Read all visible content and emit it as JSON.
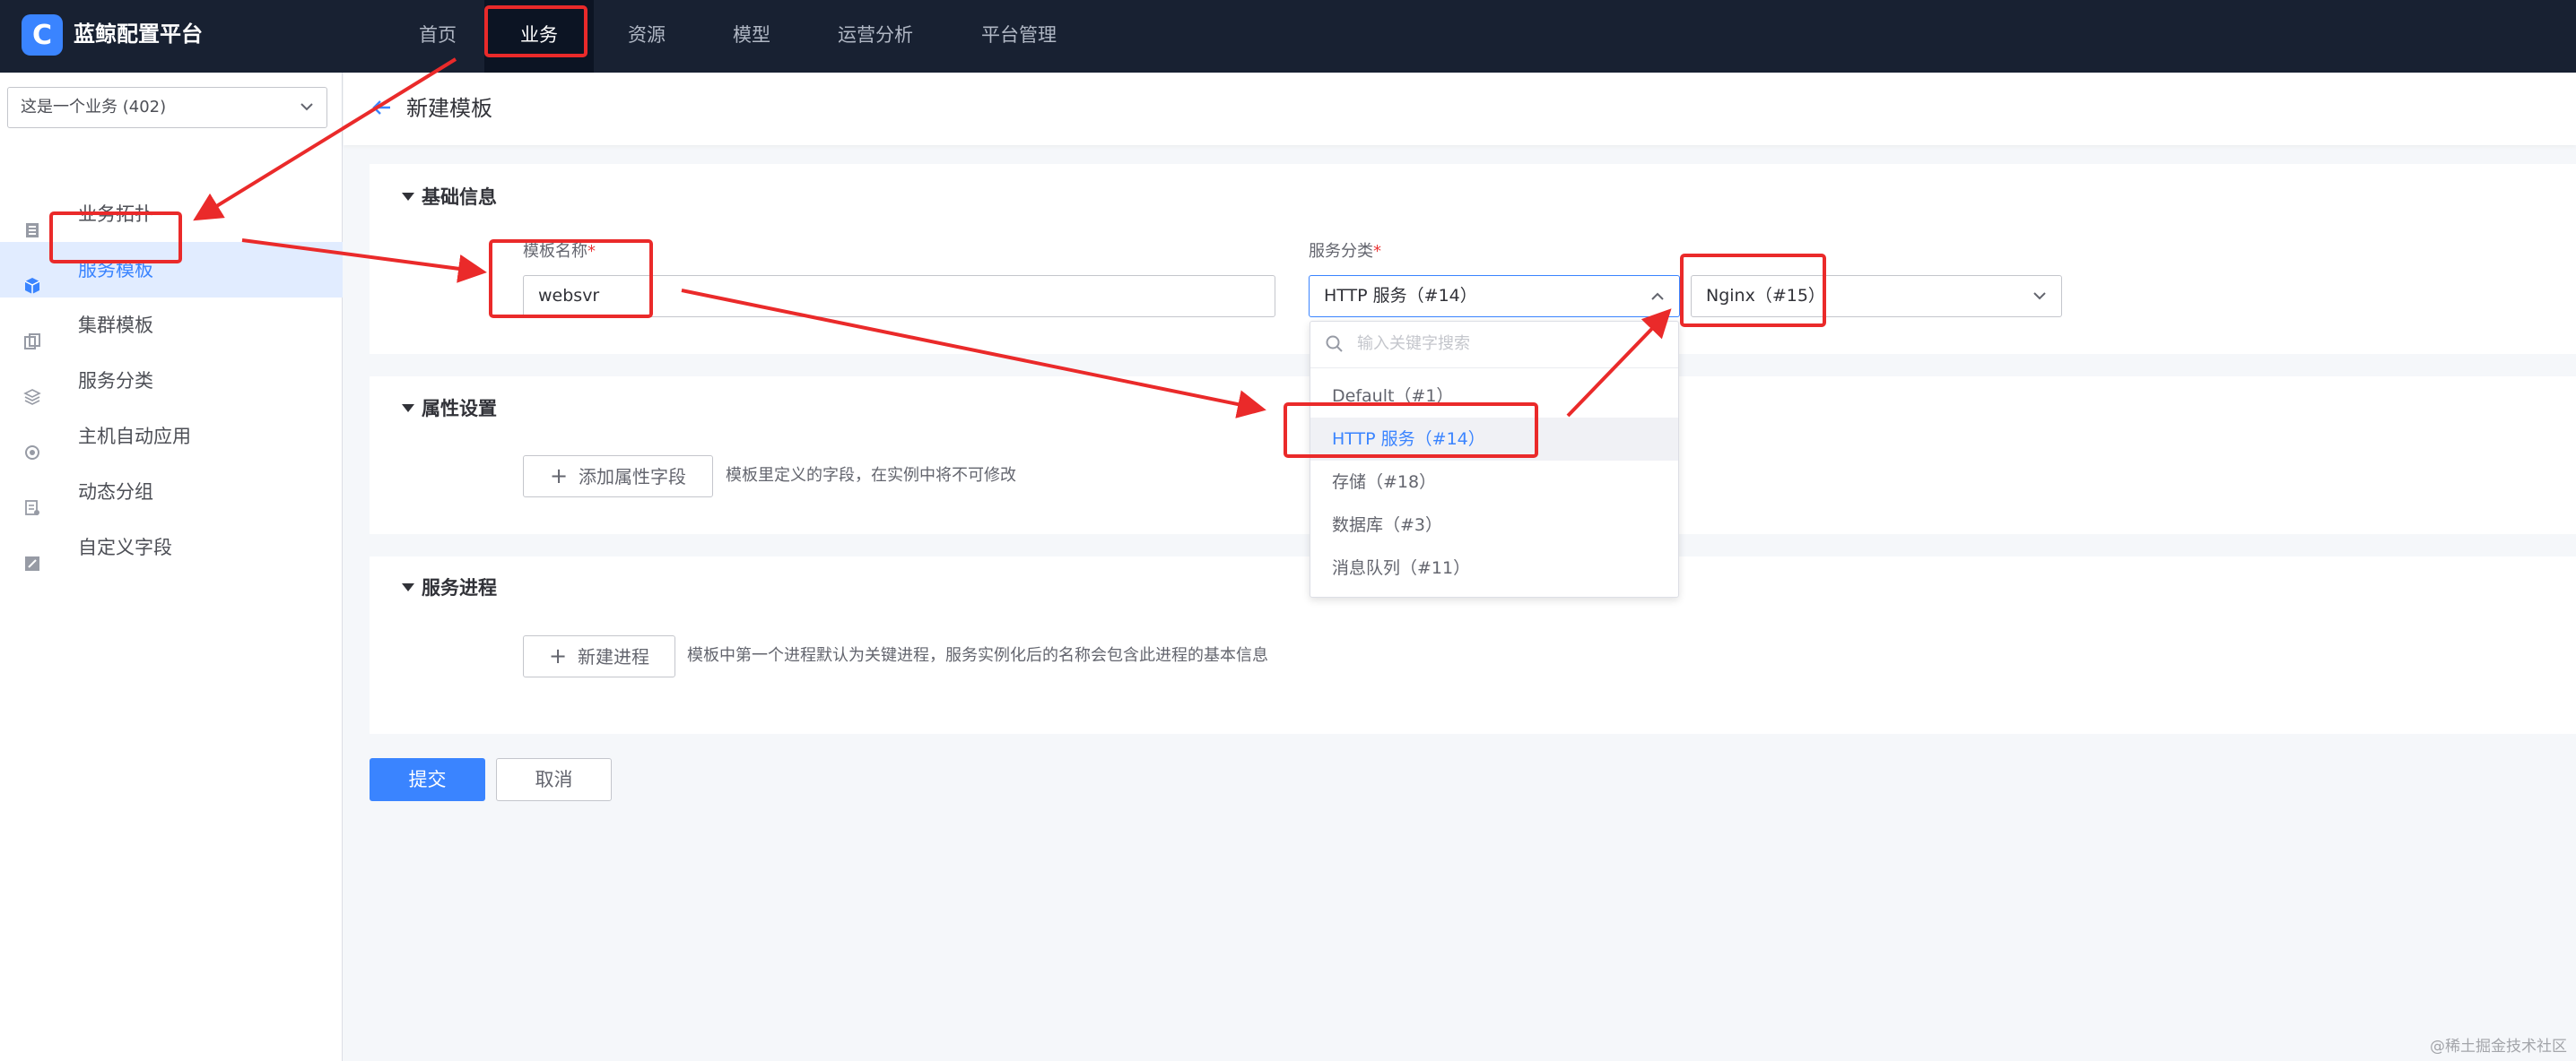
{
  "app": {
    "logo_letter": "C",
    "brand": "蓝鲸配置平台"
  },
  "nav": {
    "items": [
      {
        "label": "首页"
      },
      {
        "label": "业务"
      },
      {
        "label": "资源"
      },
      {
        "label": "模型"
      },
      {
        "label": "运营分析"
      },
      {
        "label": "平台管理"
      }
    ],
    "active_index": 1
  },
  "sidebar": {
    "business_select": "这是一个业务 (402)",
    "items": [
      {
        "label": "业务拓扑",
        "icon": "topology-icon"
      },
      {
        "label": "服务模板",
        "icon": "cube-icon"
      },
      {
        "label": "集群模板",
        "icon": "cluster-template-icon"
      },
      {
        "label": "服务分类",
        "icon": "layers-icon"
      },
      {
        "label": "主机自动应用",
        "icon": "auto-apply-icon"
      },
      {
        "label": "动态分组",
        "icon": "dynamic-group-icon"
      },
      {
        "label": "自定义字段",
        "icon": "edit-field-icon"
      }
    ],
    "active_index": 1
  },
  "page": {
    "title": "新建模板"
  },
  "basic": {
    "title": "基础信息",
    "name_label": "模板名称",
    "name_value": "websvr",
    "category_label": "服务分类",
    "required_mark": "*",
    "category_primary": "HTTP 服务（#14）",
    "category_secondary": "Nginx（#15）"
  },
  "attr": {
    "title": "属性设置",
    "add_button": "添加属性字段",
    "hint": "模板里定义的字段，在实例中将不可修改"
  },
  "process": {
    "title": "服务进程",
    "add_button": "新建进程",
    "hint": "模板中第一个进程默认为关键进程，服务实例化后的名称会包含此进程的基本信息"
  },
  "actions": {
    "submit": "提交",
    "cancel": "取消"
  },
  "dropdown": {
    "search_placeholder": "输入关键字搜索",
    "options": [
      {
        "label": "Default（#1）"
      },
      {
        "label": "HTTP 服务（#14）"
      },
      {
        "label": "存储（#18）"
      },
      {
        "label": "数据库（#3）"
      },
      {
        "label": "消息队列（#11）"
      }
    ],
    "selected_index": 1
  },
  "watermark": "@稀土掘金技术社区",
  "colors": {
    "accent": "#3a84ff",
    "topbar": "#182132",
    "annotation": "#ea2a2a"
  }
}
